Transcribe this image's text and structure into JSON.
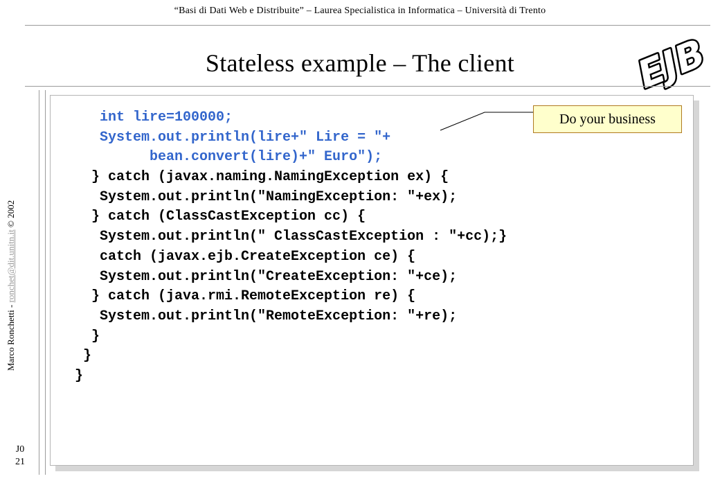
{
  "header": {
    "text": "“Basi di Dati Web e Distribuite” – Laurea Specialistica in Informatica – Università di Trento"
  },
  "title": "Stateless example – The client",
  "logo": {
    "text": "EJB"
  },
  "sidebar": {
    "author": "Marco Ronchetti  -  ",
    "email": "ronchet@dit.unitn.it",
    "year": "  © 2002"
  },
  "slide_id": {
    "section": "J0",
    "page": "21"
  },
  "code": {
    "lines": [
      {
        "text": "   int lire=100000;",
        "color": "#3366cc"
      },
      {
        "text": "   System.out.println(lire+\" Lire = \"+",
        "color": "#3366cc"
      },
      {
        "text": "         bean.convert(lire)+\" Euro\");",
        "color": "#3366cc"
      },
      {
        "text": "  } catch (javax.naming.NamingException ex) {",
        "color": "#000000"
      },
      {
        "text": "   System.out.println(\"NamingException: \"+ex);",
        "color": "#000000"
      },
      {
        "text": "  } catch (ClassCastException cc) {",
        "color": "#000000"
      },
      {
        "text": "   System.out.println(\" ClassCastException : \"+cc);}",
        "color": "#000000"
      },
      {
        "text": "   catch (javax.ejb.CreateException ce) {",
        "color": "#000000"
      },
      {
        "text": "   System.out.println(\"CreateException: \"+ce);",
        "color": "#000000"
      },
      {
        "text": "  } catch (java.rmi.RemoteException re) {",
        "color": "#000000"
      },
      {
        "text": "   System.out.println(\"RemoteException: \"+re);",
        "color": "#000000"
      },
      {
        "text": "  }",
        "color": "#000000"
      },
      {
        "text": " }",
        "color": "#000000"
      },
      {
        "text": "}",
        "color": "#000000"
      }
    ]
  },
  "callout": {
    "text": "Do your business"
  }
}
